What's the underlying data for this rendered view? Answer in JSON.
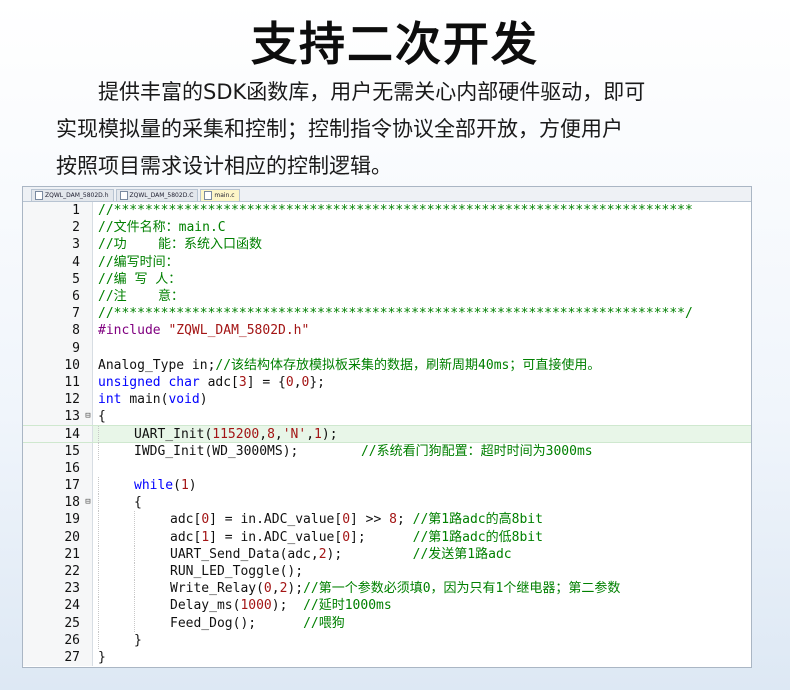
{
  "title": "支持二次开发",
  "intro_lines": [
    "提供丰富的SDK函数库，用户无需关心内部硬件驱动，即可",
    "实现模拟量的采集和控制；控制指令协议全部开放，方便用户",
    "按照项目需求设计相应的控制逻辑。"
  ],
  "tabs": [
    {
      "label": "ZQWL_DAM_5802D.h",
      "active": false
    },
    {
      "label": "ZQWL_DAM_5802D.C",
      "active": false
    },
    {
      "label": "main.c",
      "active": true
    }
  ],
  "colors": {
    "comment": "#008000",
    "keyword": "#0000ff",
    "string": "#a31515",
    "number": "#a31515",
    "preproc": "#800080",
    "default": "#111111"
  },
  "code": [
    {
      "n": "1",
      "fold": "",
      "indent": 0,
      "hl": false,
      "tokens": [
        [
          "c",
          "//**************************************************************************"
        ]
      ]
    },
    {
      "n": "2",
      "fold": "",
      "indent": 0,
      "hl": false,
      "tokens": [
        [
          "c",
          "//文件名称：main.C"
        ]
      ]
    },
    {
      "n": "3",
      "fold": "",
      "indent": 0,
      "hl": false,
      "tokens": [
        [
          "c",
          "//功    能：系统入口函数"
        ]
      ]
    },
    {
      "n": "4",
      "fold": "",
      "indent": 0,
      "hl": false,
      "tokens": [
        [
          "c",
          "//编写时间："
        ]
      ]
    },
    {
      "n": "5",
      "fold": "",
      "indent": 0,
      "hl": false,
      "tokens": [
        [
          "c",
          "//编 写 人："
        ]
      ]
    },
    {
      "n": "6",
      "fold": "",
      "indent": 0,
      "hl": false,
      "tokens": [
        [
          "c",
          "//注    意："
        ]
      ]
    },
    {
      "n": "7",
      "fold": "",
      "indent": 0,
      "hl": false,
      "tokens": [
        [
          "c",
          "//*************************************************************************/"
        ]
      ]
    },
    {
      "n": "8",
      "fold": "",
      "indent": 0,
      "hl": false,
      "tokens": [
        [
          "p",
          "#include "
        ],
        [
          "s",
          "\"ZQWL_DAM_5802D.h\""
        ]
      ]
    },
    {
      "n": "9",
      "fold": "",
      "indent": 0,
      "hl": false,
      "tokens": []
    },
    {
      "n": "10",
      "fold": "",
      "indent": 0,
      "hl": false,
      "tokens": [
        [
          "d",
          "Analog_Type in;"
        ],
        [
          "c",
          "//该结构体存放模拟板采集的数据，刷新周期40ms；可直接使用。"
        ]
      ]
    },
    {
      "n": "11",
      "fold": "",
      "indent": 0,
      "hl": false,
      "tokens": [
        [
          "k",
          "unsigned char "
        ],
        [
          "d",
          "adc["
        ],
        [
          "n",
          "3"
        ],
        [
          "d",
          "] = {"
        ],
        [
          "n",
          "0"
        ],
        [
          "d",
          ","
        ],
        [
          "n",
          "0"
        ],
        [
          "d",
          "};"
        ]
      ]
    },
    {
      "n": "12",
      "fold": "",
      "indent": 0,
      "hl": false,
      "tokens": [
        [
          "k",
          "int "
        ],
        [
          "d",
          "main("
        ],
        [
          "k",
          "void"
        ],
        [
          "d",
          ")"
        ]
      ]
    },
    {
      "n": "13",
      "fold": "⊟",
      "indent": 0,
      "hl": false,
      "tokens": [
        [
          "d",
          "{"
        ]
      ]
    },
    {
      "n": "14",
      "fold": "",
      "indent": 1,
      "hl": true,
      "tokens": [
        [
          "d",
          "UART_Init("
        ],
        [
          "n",
          "115200"
        ],
        [
          "d",
          ","
        ],
        [
          "n",
          "8"
        ],
        [
          "d",
          ","
        ],
        [
          "s",
          "'N'"
        ],
        [
          "d",
          ","
        ],
        [
          "n",
          "1"
        ],
        [
          "d",
          ");"
        ]
      ]
    },
    {
      "n": "15",
      "fold": "",
      "indent": 1,
      "hl": false,
      "tokens": [
        [
          "d",
          "IWDG_Init(WD_3000MS);        "
        ],
        [
          "c",
          "//系统看门狗配置：超时时间为3000ms"
        ]
      ]
    },
    {
      "n": "16",
      "fold": "",
      "indent": 0,
      "hl": false,
      "tokens": []
    },
    {
      "n": "17",
      "fold": "",
      "indent": 1,
      "hl": false,
      "tokens": [
        [
          "k",
          "while"
        ],
        [
          "d",
          "("
        ],
        [
          "n",
          "1"
        ],
        [
          "d",
          ")"
        ]
      ]
    },
    {
      "n": "18",
      "fold": "⊟",
      "indent": 1,
      "hl": false,
      "tokens": [
        [
          "d",
          "{"
        ]
      ]
    },
    {
      "n": "19",
      "fold": "",
      "indent": 2,
      "hl": false,
      "tokens": [
        [
          "d",
          "adc["
        ],
        [
          "n",
          "0"
        ],
        [
          "d",
          "] = in.ADC_value["
        ],
        [
          "n",
          "0"
        ],
        [
          "d",
          "] >> "
        ],
        [
          "n",
          "8"
        ],
        [
          "d",
          "; "
        ],
        [
          "c",
          "//第1路adc的高8bit"
        ]
      ]
    },
    {
      "n": "20",
      "fold": "",
      "indent": 2,
      "hl": false,
      "tokens": [
        [
          "d",
          "adc["
        ],
        [
          "n",
          "1"
        ],
        [
          "d",
          "] = in.ADC_value["
        ],
        [
          "n",
          "0"
        ],
        [
          "d",
          "];      "
        ],
        [
          "c",
          "//第1路adc的低8bit"
        ]
      ]
    },
    {
      "n": "21",
      "fold": "",
      "indent": 2,
      "hl": false,
      "tokens": [
        [
          "d",
          "UART_Send_Data(adc,"
        ],
        [
          "n",
          "2"
        ],
        [
          "d",
          ");         "
        ],
        [
          "c",
          "//发送第1路adc"
        ]
      ]
    },
    {
      "n": "22",
      "fold": "",
      "indent": 2,
      "hl": false,
      "tokens": [
        [
          "d",
          "RUN_LED_Toggle();"
        ]
      ]
    },
    {
      "n": "23",
      "fold": "",
      "indent": 2,
      "hl": false,
      "tokens": [
        [
          "d",
          "Write_Relay("
        ],
        [
          "n",
          "0"
        ],
        [
          "d",
          ","
        ],
        [
          "n",
          "2"
        ],
        [
          "d",
          ");"
        ],
        [
          "c",
          "//第一个参数必须填0，因为只有1个继电器；第二参数"
        ]
      ]
    },
    {
      "n": "24",
      "fold": "",
      "indent": 2,
      "hl": false,
      "tokens": [
        [
          "d",
          "Delay_ms("
        ],
        [
          "n",
          "1000"
        ],
        [
          "d",
          ");  "
        ],
        [
          "c",
          "//延时1000ms"
        ]
      ]
    },
    {
      "n": "25",
      "fold": "",
      "indent": 2,
      "hl": false,
      "tokens": [
        [
          "d",
          "Feed_Dog();      "
        ],
        [
          "c",
          "//喂狗"
        ]
      ]
    },
    {
      "n": "26",
      "fold": "",
      "indent": 1,
      "hl": false,
      "tokens": [
        [
          "d",
          "}"
        ]
      ]
    },
    {
      "n": "27",
      "fold": "",
      "indent": 0,
      "hl": false,
      "tokens": [
        [
          "d",
          "}"
        ]
      ]
    }
  ]
}
